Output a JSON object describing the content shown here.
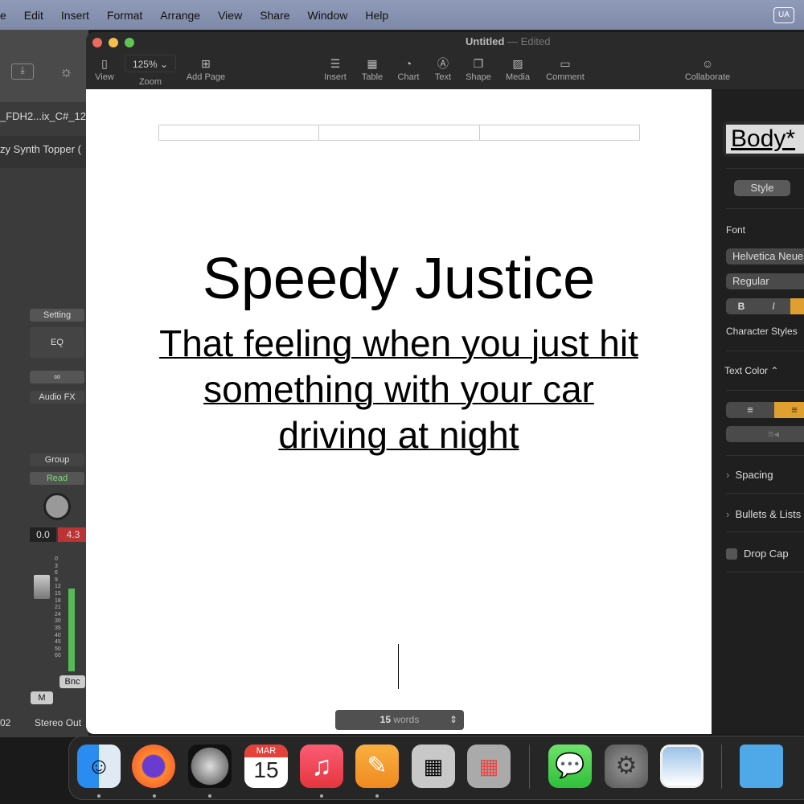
{
  "menubar": {
    "items": [
      "e",
      "Edit",
      "Insert",
      "Format",
      "Arrange",
      "View",
      "Share",
      "Window",
      "Help"
    ]
  },
  "logic": {
    "track1": "_FDH2...ix_C#_12",
    "track2": "zy Synth Topper (",
    "setting": "Setting",
    "eq": "EQ",
    "audio_fx": "Audio FX",
    "group": "Group",
    "read": "Read",
    "vol": "0.0",
    "peak": "4.3",
    "meter_scale": [
      "0",
      "3",
      "6",
      "9",
      "12",
      "15",
      "18",
      "21",
      "24",
      "30",
      "35",
      "40",
      "45",
      "50",
      "60"
    ],
    "bnc": "Bnc",
    "mute": "M",
    "output": "Stereo Out",
    "left_label": "02"
  },
  "window": {
    "title": "Untitled",
    "status": "Edited",
    "zoom": "125%",
    "toolbar": [
      {
        "label": "View",
        "icon": "sidebar-icon"
      },
      {
        "label": "Zoom"
      },
      {
        "label": "Add Page",
        "icon": "plus-square-icon"
      },
      {
        "label": "Insert",
        "icon": "insert-icon"
      },
      {
        "label": "Table",
        "icon": "table-icon"
      },
      {
        "label": "Chart",
        "icon": "chart-icon"
      },
      {
        "label": "Text",
        "icon": "text-box-icon"
      },
      {
        "label": "Shape",
        "icon": "shape-icon"
      },
      {
        "label": "Media",
        "icon": "media-icon"
      },
      {
        "label": "Comment",
        "icon": "comment-icon"
      },
      {
        "label": "Collaborate",
        "icon": "collaborate-icon"
      }
    ]
  },
  "document": {
    "title": "Speedy Justice",
    "subtitle": "That feeling when you just hit something with your car driving at night",
    "word_count": "15",
    "word_label": "words"
  },
  "sidebar": {
    "style_name": "Body*",
    "tab": "Style",
    "font_label": "Font",
    "font": "Helvetica Neue",
    "weight": "Regular",
    "bold": "B",
    "italic": "I",
    "char_styles": "Character Styles",
    "text_color": "Text Color ⌃",
    "spacing": "Spacing",
    "bullets": "Bullets & Lists",
    "drop_cap": "Drop Cap",
    "accent": "#e0a030"
  },
  "dock": {
    "calendar_month": "MAR",
    "calendar_day": "15",
    "apps": [
      "Finder",
      "Firefox",
      "Logic Pro",
      "Calendar",
      "Music",
      "Pages",
      "Calculator",
      "Launchpad",
      "Messages",
      "System Settings",
      "Preview",
      "Folder"
    ]
  }
}
